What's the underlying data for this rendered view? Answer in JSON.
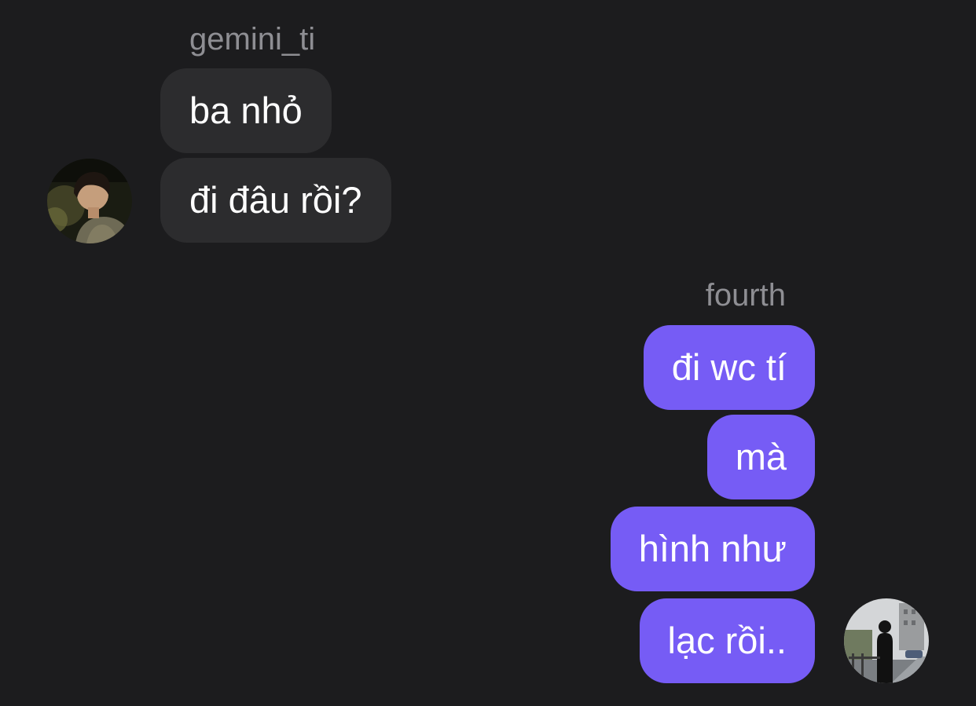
{
  "conversation": {
    "incoming": {
      "sender_name": "gemini_ti",
      "messages": [
        {
          "text": "ba nhỏ"
        },
        {
          "text": "đi đâu rồi?"
        }
      ]
    },
    "outgoing": {
      "sender_name": "fourth",
      "messages": [
        {
          "text": "đi wc tí"
        },
        {
          "text": "mà"
        },
        {
          "text": "hình như"
        },
        {
          "text": "lạc rồi.."
        }
      ]
    }
  },
  "colors": {
    "background": "#1c1c1e",
    "incoming_bubble": "#2c2c2e",
    "outgoing_bubble": "#765cf5",
    "sender_name_text": "#8e8e93",
    "message_text": "#ffffff"
  }
}
